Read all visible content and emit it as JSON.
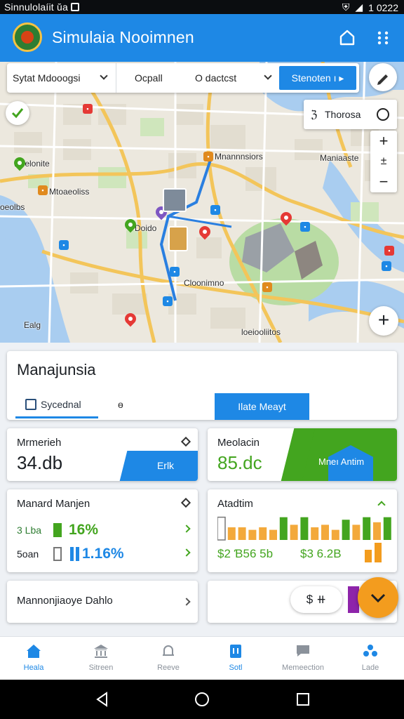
{
  "status_bar": {
    "left_text": "Sinnulolaíit ŭa",
    "time": "1 0222"
  },
  "app": {
    "title": "Simulaia Nooimnen"
  },
  "filters": {
    "city_select": "Sytat Mdooogsi",
    "segment_2": "Ocpall",
    "segment_3": "O dactcst",
    "search_button": "Stenoten ı ▸"
  },
  "map": {
    "layer_label": "Thorosa",
    "zoom_in": "+",
    "zoom_out": "−",
    "labels": {
      "l1": "Doelonite",
      "l2": "Mtoaeoliss",
      "l3": "Mnannnsiors",
      "l4": "Maniaaste",
      "l5": "oeolbs",
      "l6": "Doido",
      "l7": "Cloonimno",
      "l8": "Ealg",
      "l9": "loeiooliitos"
    }
  },
  "panel": {
    "title": "Manajunsia",
    "tab_active": "Sycednal",
    "tab_icon_glyph": "ɵ",
    "action_button": "Ilate Meayt"
  },
  "cards": {
    "card1": {
      "title": "Mrmerieh",
      "value": "34.db",
      "button": "Erlk"
    },
    "card2": {
      "title": "Meolacin",
      "value": "85.dc",
      "badge": "Mneı Antim"
    },
    "card3": {
      "title": "Manard Manjen",
      "rows": [
        {
          "label": "3 Lba",
          "value": "16%"
        },
        {
          "label": "5oan",
          "value": "1.16%"
        }
      ]
    },
    "card4": {
      "title": "Atadtim",
      "footer_left": "$2 Ɓ56 5b",
      "footer_right": "$3 6.2B",
      "bars": [
        0.9,
        0.5,
        0.5,
        0.4,
        0.5,
        0.4,
        0.9,
        0.6,
        0.9,
        0.5,
        0.6,
        0.4,
        0.8,
        0.6,
        0.9,
        0.7,
        0.9
      ]
    },
    "card5": {
      "title": "Mannonjiaoye Dahlo"
    },
    "card6": {
      "pill": "$ ⧺"
    }
  },
  "colors": {
    "primary": "#1e88e5",
    "green": "#43a51f",
    "orange": "#f39c1e"
  },
  "bottom_nav": [
    {
      "label": "Heala",
      "icon": "home-icon",
      "active": true
    },
    {
      "label": "Sitreen",
      "icon": "bank-icon",
      "active": false
    },
    {
      "label": "Reeve",
      "icon": "bell-icon",
      "active": false
    },
    {
      "label": "Sotl",
      "icon": "clipboard-icon",
      "active": true
    },
    {
      "label": "Memeection",
      "icon": "chat-icon",
      "active": false
    },
    {
      "label": "Lade",
      "icon": "people-icon",
      "active": false
    }
  ]
}
